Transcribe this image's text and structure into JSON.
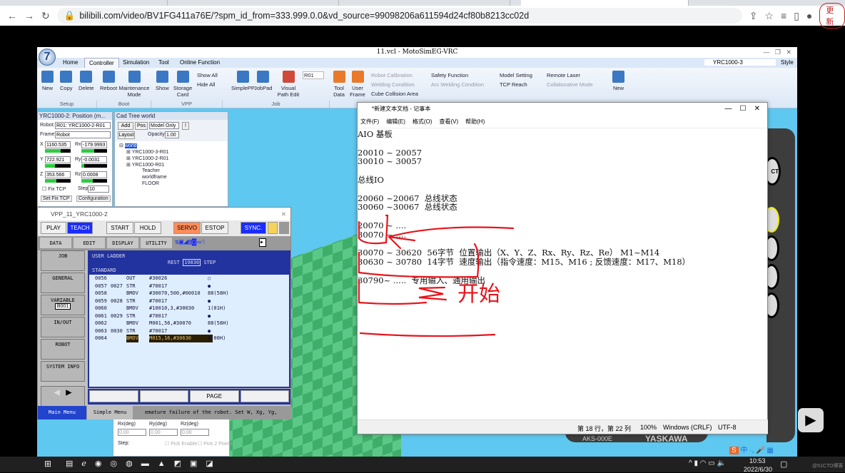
{
  "browser": {
    "url": "bilibili.com/video/BV1FG411a76E/?spm_id_from=333.999.0.0&vd_source=99098206a611594d24cf80b8213cc02d",
    "update_label": "更新"
  },
  "app": {
    "title": "11.vcl - MotoSimEG-VRC",
    "controller_select": "YRC1000-3",
    "style_label": "Style",
    "tabs": [
      "Home",
      "Controller",
      "Simulation",
      "Tool",
      "Online Function"
    ],
    "active_tab": "Controller",
    "ribbon": {
      "setup": [
        "New",
        "Copy",
        "Delete"
      ],
      "setup_label": "Setup",
      "boot": [
        "Reboot",
        "Maintenance Mode"
      ],
      "boot_label": "Boot",
      "vpp": [
        "Show",
        "Storage Card"
      ],
      "vpp_small": [
        "Show All",
        "Hide All"
      ],
      "vpp_label": "VPP",
      "job": [
        "SimplePP",
        "JobPad",
        "Visual Path Edit"
      ],
      "job_select": "R01",
      "job_label": "Job",
      "misc": [
        "Tool Data",
        "User Frame"
      ],
      "small": [
        "Robot Calibration",
        "Welding Condition",
        "Cube Collision Area",
        "Safety Function",
        "Arc Welding Condition",
        "Model Setting",
        "TCP Reach",
        "Remote Laser",
        "Collaborative Mode"
      ],
      "new_label": "New"
    }
  },
  "position_panel": {
    "title": "YRC1000-2: Position (m...",
    "robot_label": "Robot:",
    "robot": "R01: YRC1000-2-R01",
    "frame_label": "Frame:",
    "frame": "Robot",
    "axes": [
      {
        "l": "X",
        "v": "1160.535",
        "r": "Rx",
        "rv": "-179.9993"
      },
      {
        "l": "Y",
        "v": "722.921",
        "r": "Ry",
        "rv": "-0.0031"
      },
      {
        "l": "Z",
        "v": "353.566",
        "r": "Rz",
        "rv": "0.0008"
      }
    ],
    "fix_tcp": "Fix TCP",
    "step_label": "Step",
    "step": "10",
    "set_fix_tcp": "Set Fix TCP",
    "configuration": "Configuration"
  },
  "cad_tree": {
    "title": "Cad Tree world",
    "add": "Add",
    "pos": "Pos",
    "mode": "Model Only",
    "excl": "!",
    "layout": "Layout",
    "opacity_label": "Opacity:",
    "opacity": "1.00",
    "items": [
      "world",
      "YRC1000-3-R01",
      "YRC1000-2-R01",
      "YRC1000-R01",
      "Teacher",
      "worldframe",
      "FLOOR"
    ]
  },
  "vpp": {
    "title": "VPP_11_YRC1000-2",
    "buttons": [
      "PLAY",
      "TEACH",
      "START",
      "HOLD",
      "SERVO ON",
      "ESTOP",
      "SYNC."
    ],
    "menus": [
      "DATA",
      "EDIT",
      "DISPLAY",
      "UTILITY"
    ],
    "side": [
      "JOB",
      "GENERAL",
      "VARIABLE",
      "IN/OUT",
      "ROBOT",
      "SYSTEM INFO"
    ],
    "variable_badge": "B001",
    "ladder_title": "USER LADDER",
    "rest_label": "REST",
    "rest_value": "19830",
    "step_label": "STEP",
    "standard": "STANDARD",
    "rows": [
      [
        "0056",
        "",
        "OUT",
        "#30026",
        "○"
      ],
      [
        "0057",
        "0027",
        "STR",
        "#70017",
        "●"
      ],
      [
        "0058",
        "",
        "BMOV",
        "#30070,500,#00010",
        "88(58H)"
      ],
      [
        "0059",
        "0028",
        "STR",
        "#70017",
        "●"
      ],
      [
        "0060",
        "",
        "BMOV",
        "#10010,3,#30030",
        "1(01H)"
      ],
      [
        "0061",
        "0029",
        "STR",
        "#70017",
        "●"
      ],
      [
        "0062",
        "",
        "BMOV",
        "M001,56,#30070",
        "88(58H)"
      ],
      [
        "0063",
        "0030",
        "STR",
        "#70017",
        "●"
      ],
      [
        "0064",
        "",
        "BMOV",
        "M015,16,#30630",
        "0(00H)"
      ]
    ],
    "page": "PAGE",
    "main_menu": "Main Menu",
    "simple_menu": "Simple Menu",
    "message": "emature failure of the robot. Set W, Xg, Yg,"
  },
  "lower_panel": {
    "labels": [
      "Rx(deg)",
      "Ry(deg)",
      "Rz(deg)"
    ],
    "values": [
      "0.00",
      "0.00",
      "0.00"
    ],
    "step": "Step:",
    "pick_enable": "Pick Enable",
    "pick_2": "Pick 2 Points"
  },
  "notepad": {
    "title": "*新建文本文档 - 记事本",
    "menu": [
      "文件(F)",
      "编辑(E)",
      "格式(O)",
      "查看(V)",
      "帮助(H)"
    ],
    "text": "AIO 基板\n\n20010 ~ 20057\n30010 ~ 30057\n\n总线IO\n\n20060 ~20067  总线状态\n30060 ~30067  总线状态\n\n20070 ~ ....\n30070 ~ ....\n\n30070 ~ 30620  56字节  位置输出（X、Y、Z、Rx、Ry、Rz、Re） M1~M14\n30630 ~ 30780  14字节  速度输出（指令速度：M15、M16 ; 反馈速度：M17、M18）\n\n30790~ .....  专用输入、通用输出",
    "annotation": "开始",
    "status": {
      "position": "第 18 行，第 22 列",
      "zoom": "100%",
      "eol": "Windows (CRLF)",
      "encoding": "UTF-8"
    }
  },
  "pendant": {
    "model": "AKS-000E",
    "brand": "YASKAWA",
    "label": "CT"
  },
  "ime": "中",
  "taskbar": {
    "time": "10:53",
    "date": "2022/6/30"
  },
  "watermark": "@51CTO博客",
  "colors": {
    "teach": "#1a2cff",
    "servo": "#ff8c5a",
    "ladder": "#2233a0",
    "annotation": "#e8141c"
  }
}
